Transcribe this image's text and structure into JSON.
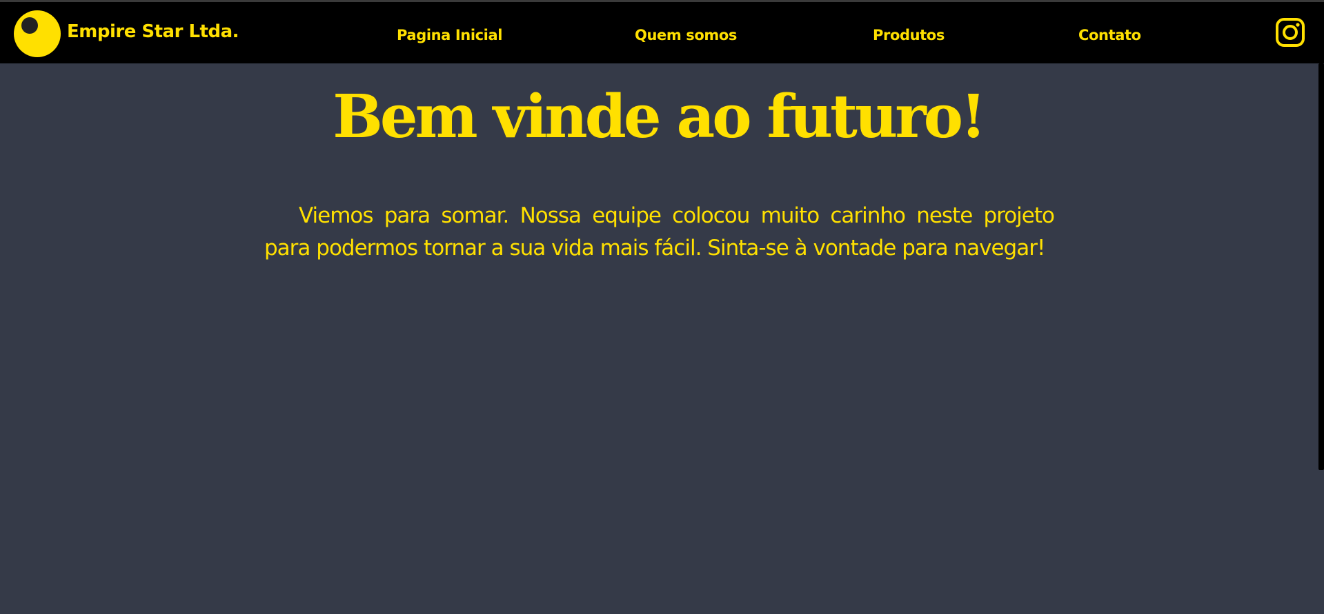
{
  "header": {
    "brand": "Empire Star Ltda.",
    "logo_icon": "circle-eye-logo-icon",
    "nav": [
      {
        "label": "Pagina Inicial"
      },
      {
        "label": "Quem somos"
      },
      {
        "label": "Produtos"
      },
      {
        "label": "Contato"
      }
    ],
    "social_icon": "instagram-icon"
  },
  "main": {
    "title": "Bem vinde ao futuro!",
    "paragraph": "Viemos para somar. Nossa equipe colocou muito carinho neste projeto para podermos tornar a sua vida mais fácil. Sinta-se à vontade para navegar!"
  },
  "colors": {
    "accent": "#ffe000",
    "navbar_bg": "#000000",
    "page_bg": "#353a48"
  }
}
